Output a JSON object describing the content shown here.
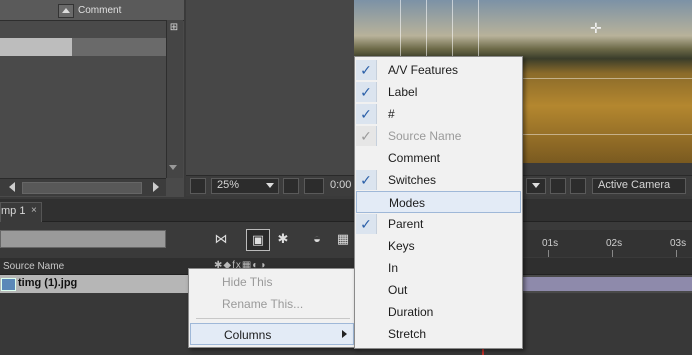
{
  "project_panel": {
    "comment_header": "Comment"
  },
  "viewer": {
    "zoom_value": "25%",
    "timecode": "0:00",
    "camera_select": "Active Camera"
  },
  "comp_tab": {
    "label": "mp 1",
    "close_glyph": "×"
  },
  "timeline": {
    "source_name_header": "Source Name",
    "layer_name": "timg (1).jpg",
    "ruler_labels": [
      "01s",
      "02s",
      "03s"
    ]
  },
  "context_menu": {
    "items": [
      {
        "label": "Hide This",
        "enabled": false
      },
      {
        "label": "Rename This...",
        "enabled": false
      },
      {
        "label": "Columns",
        "enabled": true,
        "has_submenu": true
      }
    ]
  },
  "columns_submenu": {
    "items": [
      {
        "label": "A/V Features",
        "checked": true,
        "enabled": true
      },
      {
        "label": "Label",
        "checked": true,
        "enabled": true
      },
      {
        "label": "#",
        "checked": true,
        "enabled": true
      },
      {
        "label": "Source Name",
        "checked": true,
        "enabled": false
      },
      {
        "label": "Comment",
        "checked": false,
        "enabled": true
      },
      {
        "label": "Switches",
        "checked": true,
        "enabled": true
      },
      {
        "label": "Modes",
        "checked": false,
        "enabled": true,
        "highlighted": true
      },
      {
        "label": "Parent",
        "checked": true,
        "enabled": true
      },
      {
        "label": "Keys",
        "checked": false,
        "enabled": true
      },
      {
        "label": "In",
        "checked": false,
        "enabled": true
      },
      {
        "label": "Out",
        "checked": false,
        "enabled": true
      },
      {
        "label": "Duration",
        "checked": false,
        "enabled": true
      },
      {
        "label": "Stretch",
        "checked": false,
        "enabled": true
      }
    ]
  },
  "icons": {
    "check": "✓",
    "crosshair": "✛"
  },
  "colors": {
    "menu_bg": "#f1f1f1",
    "check_blue": "#2a5fa8",
    "layer_bar": "#8e8aab",
    "playhead": "#c0302a"
  }
}
